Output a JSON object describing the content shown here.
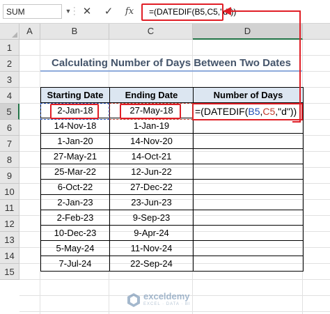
{
  "formula_bar": {
    "name_box": "SUM",
    "cancel_icon": "✕",
    "enter_icon": "✓",
    "fx_icon": "fx",
    "formula": "=(DATEDIF(B5,C5,\"d\"))"
  },
  "columns": [
    "A",
    "B",
    "C",
    "D"
  ],
  "rows": [
    "1",
    "2",
    "3",
    "4",
    "5",
    "6",
    "7",
    "8",
    "9",
    "10",
    "11",
    "12",
    "13",
    "14",
    "15"
  ],
  "title": "Calculating Number of Days Between Two Dates",
  "table": {
    "headers": [
      "Starting Date",
      "Ending Date",
      "Number of Days"
    ],
    "rows": [
      [
        "2-Jan-18",
        "27-May-18",
        ""
      ],
      [
        "14-Nov-18",
        "1-Jan-19",
        ""
      ],
      [
        "1-Jan-20",
        "14-Nov-20",
        ""
      ],
      [
        "27-May-21",
        "14-Oct-21",
        ""
      ],
      [
        "25-Mar-22",
        "12-Jun-22",
        ""
      ],
      [
        "6-Oct-22",
        "27-Dec-22",
        ""
      ],
      [
        "2-Jan-23",
        "23-Jun-23",
        ""
      ],
      [
        "2-Feb-23",
        "9-Sep-23",
        ""
      ],
      [
        "10-Dec-23",
        "9-Apr-24",
        ""
      ],
      [
        "5-May-24",
        "11-Nov-24",
        ""
      ],
      [
        "7-Jul-24",
        "22-Sep-24",
        ""
      ]
    ]
  },
  "editing_cell": {
    "prefix": "=(DATEDIF(",
    "ref_b": "B5",
    "comma1": ",",
    "ref_c": "C5",
    "suffix": ",\"d\"))"
  },
  "watermark": {
    "name": "exceldemy",
    "sub": "EXCEL · DATA · BI"
  },
  "colors": {
    "highlight": "#e01e26",
    "header_fill": "#dce6f1",
    "title_text": "#44546a"
  }
}
